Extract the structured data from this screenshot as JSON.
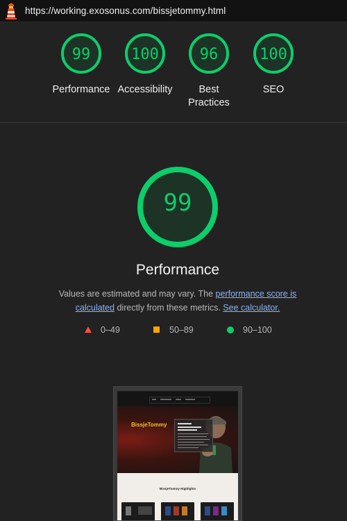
{
  "browser": {
    "url": "https://working.exosonus.com/bissjetommy.html",
    "logo_icon": "lighthouse-icon"
  },
  "summary": {
    "categories": [
      {
        "score": "99",
        "label_line1": "Performance",
        "label_line2": ""
      },
      {
        "score": "100",
        "label_line1": "Accessibility",
        "label_line2": ""
      },
      {
        "score": "96",
        "label_line1": "Best",
        "label_line2": "Practices"
      },
      {
        "score": "100",
        "label_line1": "SEO",
        "label_line2": ""
      }
    ],
    "pass_color": "#0cce6b"
  },
  "performance": {
    "score": "99",
    "title": "Performance",
    "desc_before": "Values are estimated and may vary. The ",
    "desc_link1": "performance score is calculated",
    "desc_mid": " directly from these metrics. ",
    "desc_link2": "See calculator."
  },
  "legend": {
    "fail": {
      "range": "0–49",
      "color": "#ff4e42",
      "icon": "triangle-icon"
    },
    "average": {
      "range": "50–89",
      "color": "#ffa400",
      "icon": "square-icon"
    },
    "pass": {
      "range": "90–100",
      "color": "#0cce6b",
      "icon": "circle-icon"
    }
  },
  "screenshot": {
    "brand": "BissjeTommy",
    "highlights_heading": "BissjeTommy Highlights"
  }
}
